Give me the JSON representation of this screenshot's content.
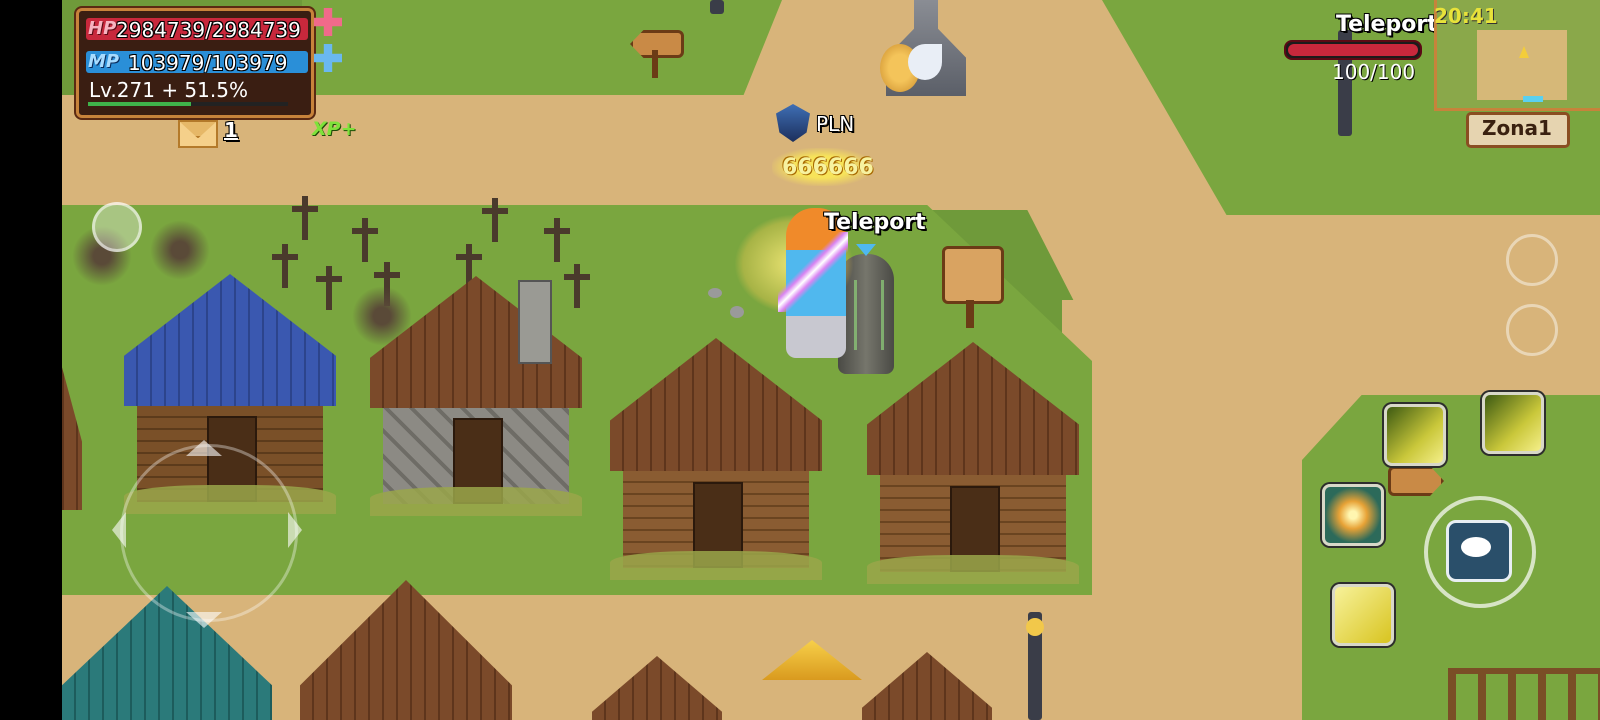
{
  "hud": {
    "hp_label": "HP",
    "hp_value": "2984739/2984739",
    "mp_label": "MP",
    "mp_value": "103979/103979",
    "level_text": "Lv.271 + 51.5%",
    "level_progress": 0.515,
    "mail_count": "1",
    "xp_badge": "XP+"
  },
  "target": {
    "name": "Teleport",
    "hp_value": "100/100",
    "hp_fraction": 1.0
  },
  "minimap": {
    "clock": "20:41",
    "zone": "Zona1"
  },
  "world": {
    "clan_tag": "PLN",
    "player_power": "666666",
    "npc_label": "Teleport"
  },
  "colors": {
    "hp_bar": "#c8283c",
    "mp_bar": "#2a8fd8",
    "xp_bar": "#3fb34a",
    "clock": "#e8e23a",
    "path": "#d8b47a",
    "grass": "#7aa63f"
  },
  "icons": {
    "hp_potion": "plus-icon",
    "mp_potion": "plus-icon",
    "mail": "mail-icon",
    "chat": "chat-bubble-icon",
    "dpad": "dpad-icon"
  }
}
